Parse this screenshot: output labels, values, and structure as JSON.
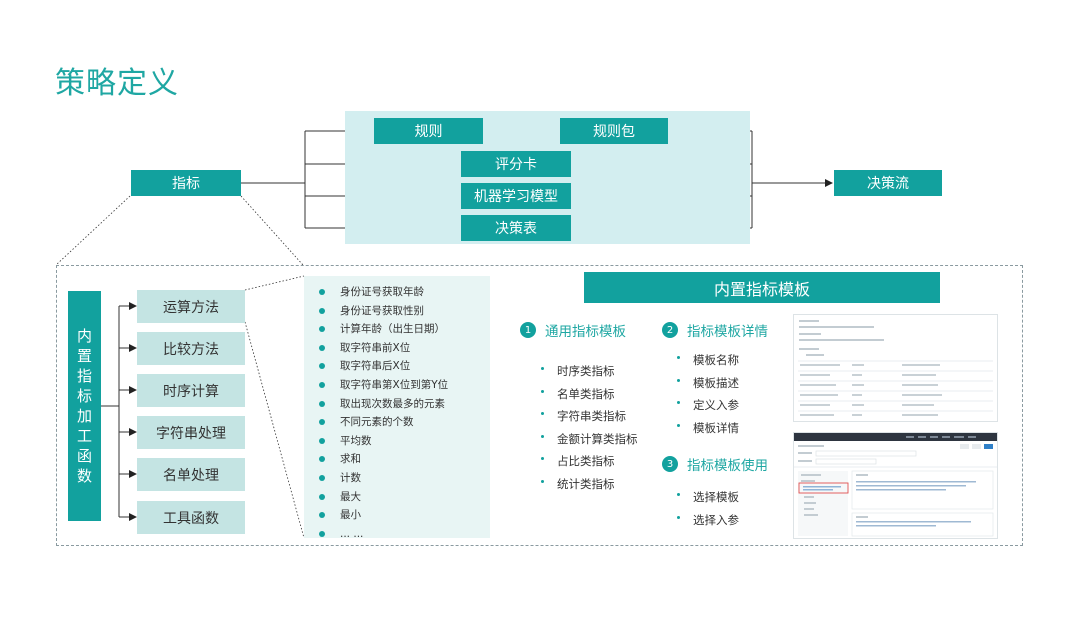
{
  "title": "策略定义",
  "flow": {
    "source": "指标",
    "rule": "规则",
    "rule_pack": "规则包",
    "scorecard": "评分卡",
    "ml_model": "机器学习模型",
    "decision_table": "决策表",
    "target": "决策流"
  },
  "builtin_functions": {
    "title": "内置指标加工函数",
    "items": [
      "运算方法",
      "比较方法",
      "时序计算",
      "字符串处理",
      "名单处理",
      "工具函数"
    ]
  },
  "operations": [
    "身份证号获取年龄",
    "身份证号获取性别",
    "计算年龄（出生日期）",
    "取字符串前X位",
    "取字符串后X位",
    "取字符串第X位到第Y位",
    "取出现次数最多的元素",
    "不同元素的个数",
    "平均数",
    "求和",
    "计数",
    "最大",
    "最小",
    "... ..."
  ],
  "templates": {
    "title": "内置指标模板",
    "section1": {
      "num": "1",
      "title": "通用指标模板",
      "items": [
        "时序类指标",
        "名单类指标",
        "字符串类指标",
        "金额计算类指标",
        "占比类指标",
        "统计类指标"
      ]
    },
    "section2": {
      "num": "2",
      "title": "指标模板详情",
      "items": [
        "模板名称",
        "模板描述",
        "定义入参",
        "模板详情"
      ]
    },
    "section3": {
      "num": "3",
      "title": "指标模板使用",
      "items": [
        "选择模板",
        "选择入参"
      ]
    }
  },
  "colors": {
    "teal": "#12a19e",
    "panel": "#d3eef0",
    "function_box": "#c4e4e3",
    "list_bg": "#e8f5f4",
    "title": "#1fa7a3"
  }
}
